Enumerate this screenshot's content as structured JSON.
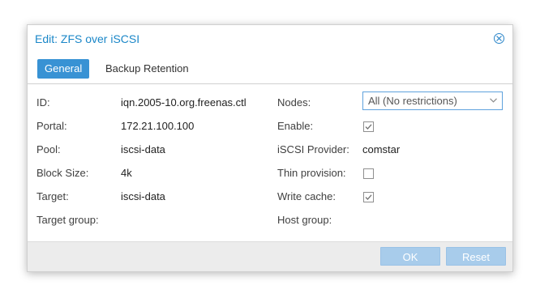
{
  "dialog": {
    "title": "Edit: ZFS over iSCSI",
    "close_icon": "close-circle-icon"
  },
  "tabs": [
    {
      "label": "General",
      "active": true
    },
    {
      "label": "Backup Retention",
      "active": false
    }
  ],
  "left_fields": [
    {
      "label": "ID:",
      "value": "iqn.2005-10.org.freenas.ctl"
    },
    {
      "label": "Portal:",
      "value": "172.21.100.100"
    },
    {
      "label": "Pool:",
      "value": "iscsi-data"
    },
    {
      "label": "Block Size:",
      "value": "4k"
    },
    {
      "label": "Target:",
      "value": "iscsi-data"
    },
    {
      "label": "Target group:",
      "value": ""
    }
  ],
  "right_fields": {
    "nodes": {
      "label": "Nodes:",
      "value": "All (No restrictions)"
    },
    "enable": {
      "label": "Enable:",
      "checked": true
    },
    "provider": {
      "label": "iSCSI Provider:",
      "value": "comstar"
    },
    "thin": {
      "label": "Thin provision:",
      "checked": false
    },
    "write_cache": {
      "label": "Write cache:",
      "checked": true
    },
    "host_group": {
      "label": "Host group:",
      "value": ""
    }
  },
  "footer": {
    "ok_label": "OK",
    "reset_label": "Reset"
  },
  "colors": {
    "accent": "#3892d4",
    "title": "#1b87c8",
    "button_disabled": "#a8cceb"
  }
}
